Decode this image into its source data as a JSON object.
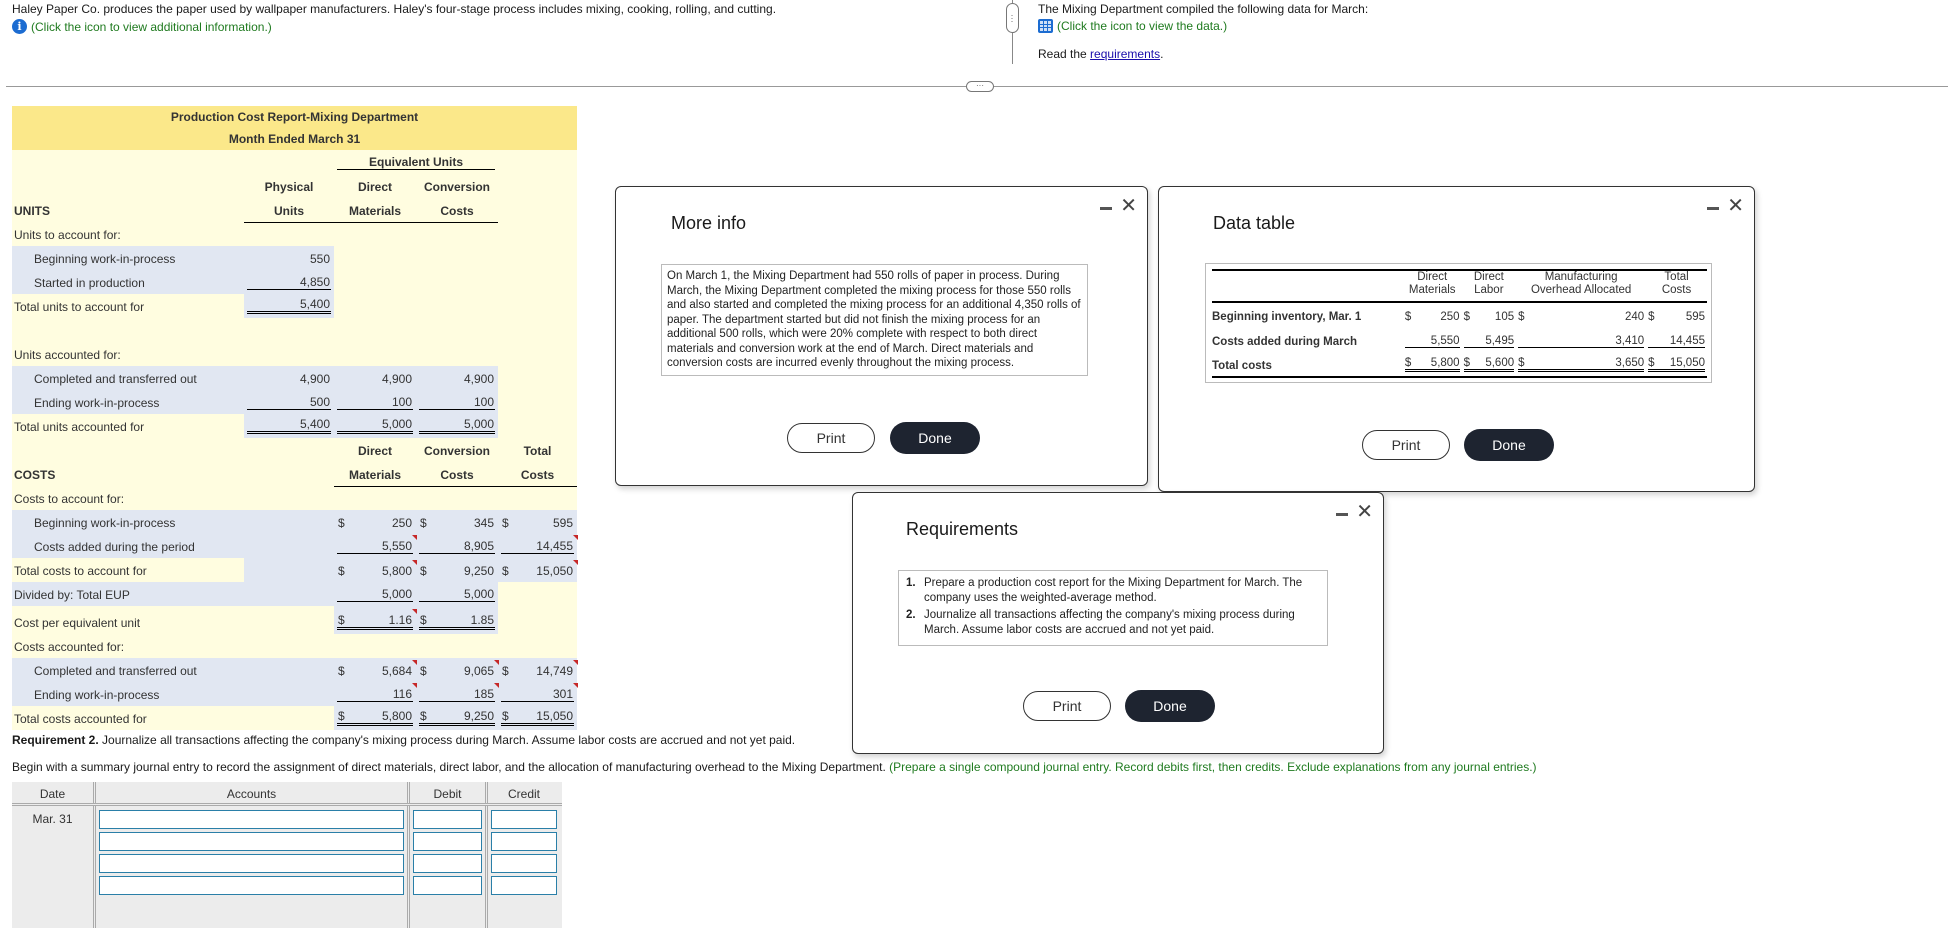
{
  "intro": {
    "text": "Haley Paper Co. produces the paper used by wallpaper manufacturers. Haley's four-stage process includes mixing, cooking, rolling, and cutting.",
    "info_link": "(Click the icon to view additional information.)"
  },
  "right_panel": {
    "text": "The Mixing Department compiled the following data for March:",
    "data_link": "(Click the icon to view the data.)",
    "read_prefix": "Read the ",
    "read_link": "requirements",
    "read_suffix": "."
  },
  "report": {
    "title": "Production Cost Report-Mixing Department",
    "subtitle": "Month Ended March 31",
    "units_header": {
      "equiv_units": "Equivalent Units",
      "physical_1": "Physical",
      "physical_2": "Units",
      "dm_1": "Direct",
      "dm_2": "Materials",
      "cc_1": "Conversion",
      "cc_2": "Costs",
      "section": "UNITS"
    },
    "units_to_account": {
      "label": "Units to account for:",
      "beginning": {
        "label": "Beginning work-in-process",
        "physical": "550"
      },
      "started": {
        "label": "Started in production",
        "physical": "4,850"
      },
      "total": {
        "label": "Total units to account for",
        "physical": "5,400"
      }
    },
    "units_accounted": {
      "label": "Units accounted for:",
      "completed": {
        "label": "Completed and transferred out",
        "physical": "4,900",
        "dm": "4,900",
        "cc": "4,900"
      },
      "ending": {
        "label": "Ending work-in-process",
        "physical": "500",
        "dm": "100",
        "cc": "100"
      },
      "total": {
        "label": "Total units accounted for",
        "physical": "5,400",
        "dm": "5,000",
        "cc": "5,000"
      }
    },
    "costs_header": {
      "section": "COSTS",
      "dm_1": "Direct",
      "dm_2": "Materials",
      "cc_1": "Conversion",
      "cc_2": "Costs",
      "total_1": "Total",
      "total_2": "Costs"
    },
    "costs_to_account": {
      "label": "Costs to account for:",
      "beginning": {
        "label": "Beginning work-in-process",
        "dm": "250",
        "cc": "345",
        "total": "595"
      },
      "added": {
        "label": "Costs added during the period",
        "dm": "5,550",
        "cc": "8,905",
        "total": "14,455"
      },
      "total": {
        "label": "Total costs to account for",
        "dm": "5,800",
        "cc": "9,250",
        "total": "15,050"
      }
    },
    "divided": {
      "label": "Divided by: Total EUP",
      "dm": "5,000",
      "cc": "5,000"
    },
    "cost_per_eu": {
      "label": "Cost per equivalent unit",
      "dm": "1.16",
      "cc": "1.85"
    },
    "costs_accounted": {
      "label": "Costs accounted for:",
      "completed": {
        "label": "Completed and transferred out",
        "dm": "5,684",
        "cc": "9,065",
        "total": "14,749"
      },
      "ending": {
        "label": "Ending work-in-process",
        "dm": "116",
        "cc": "185",
        "total": "301"
      },
      "total": {
        "label": "Total costs accounted for",
        "dm": "5,800",
        "cc": "9,250",
        "total": "15,050"
      }
    },
    "currency": "$"
  },
  "requirement2": {
    "bold": "Requirement 2.",
    "text": " Journalize all transactions affecting the company's mixing process during March. Assume labor costs are accrued and not yet paid.",
    "begin": "Begin with a summary journal entry to record the assignment of direct materials, direct labor, and the allocation of manufacturing overhead to the Mixing Department.",
    "hint": " (Prepare a single compound journal entry. Record debits first, then credits. Exclude explanations from any journal entries.)"
  },
  "journal": {
    "headers": {
      "date": "Date",
      "accounts": "Accounts",
      "debit": "Debit",
      "credit": "Credit"
    },
    "date": "Mar. 31",
    "rows": [
      {
        "account": "",
        "debit": "",
        "credit": ""
      },
      {
        "account": "",
        "debit": "",
        "credit": ""
      },
      {
        "account": "",
        "debit": "",
        "credit": ""
      },
      {
        "account": "",
        "debit": "",
        "credit": ""
      }
    ]
  },
  "more_info": {
    "title": "More info",
    "body": "On March 1, the Mixing Department had 550 rolls of paper in process. During March, the Mixing Department completed the mixing process for those 550 rolls and also started and completed the mixing process for an additional 4,350 rolls of paper. The department started but did not finish the mixing process for an additional 500 rolls, which were 20% complete with respect to both direct materials and conversion work at the end of March. Direct materials and conversion costs are incurred evenly throughout the mixing process.",
    "print": "Print",
    "done": "Done"
  },
  "data_table": {
    "title": "Data table",
    "headers": {
      "dm_1": "Direct",
      "dm_2": "Materials",
      "dl_1": "Direct",
      "dl_2": "Labor",
      "moh_1": "Manufacturing",
      "moh_2": "Overhead Allocated",
      "tc_1": "Total",
      "tc_2": "Costs"
    },
    "rows": {
      "beginning": {
        "label": "Beginning inventory, Mar. 1",
        "dm": "250",
        "dl": "105",
        "moh": "240",
        "total": "595"
      },
      "added": {
        "label": "Costs added during March",
        "dm": "5,550",
        "dl": "5,495",
        "moh": "3,410",
        "total": "14,455"
      },
      "total": {
        "label": "Total costs",
        "dm": "5,800",
        "dl": "5,600",
        "moh": "3,650",
        "total": "15,050"
      }
    },
    "currency": "$",
    "print": "Print",
    "done": "Done"
  },
  "requirements": {
    "title": "Requirements",
    "items": [
      {
        "num": "1.",
        "text": "Prepare a production cost report for the Mixing Department for March. The company uses the weighted-average method."
      },
      {
        "num": "2.",
        "text": "Journalize all transactions affecting the company's mixing process during March. Assume labor costs are accrued and not yet paid."
      }
    ],
    "print": "Print",
    "done": "Done"
  },
  "colors": {
    "report_header": "#fbe88a",
    "report_bg": "#fffde0",
    "highlight": "#e1e7f2",
    "link_green": "#1f7a1f",
    "done_button": "#1e2430",
    "info_icon": "#1c6cd1"
  }
}
